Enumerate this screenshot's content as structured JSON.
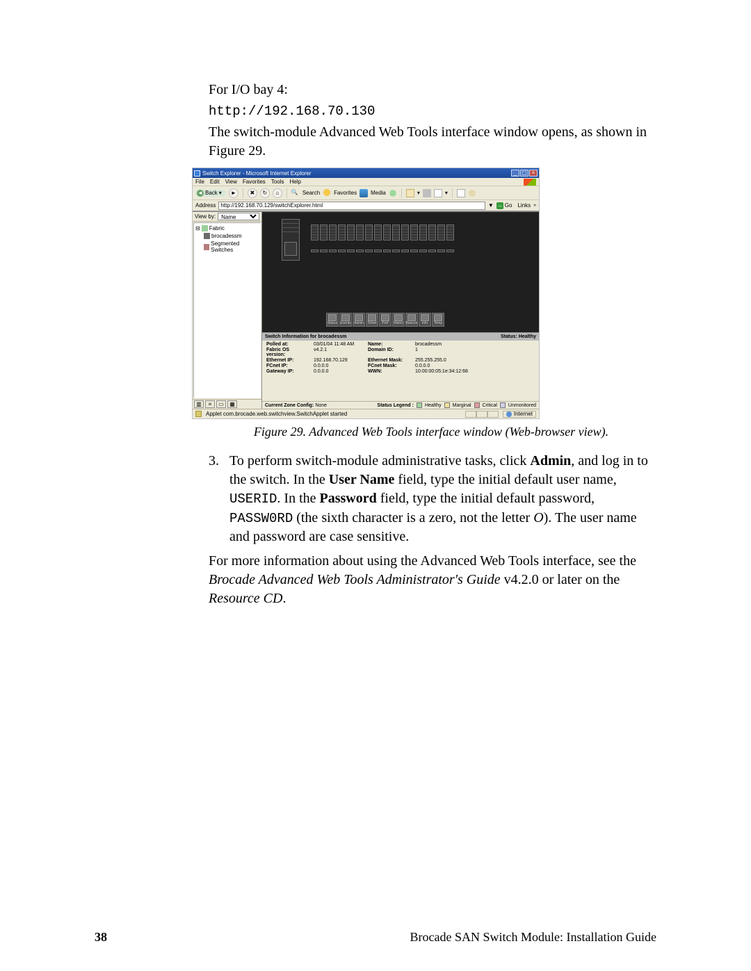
{
  "doc": {
    "bay_line": "For I/O bay 4:",
    "url": "http://192.168.70.130",
    "open_sentence": "The switch-module Advanced Web Tools interface window opens, as shown in Figure 29.",
    "caption": "Figure 29.  Advanced Web Tools interface window (Web-browser view).",
    "step3_num": "3.",
    "step3_a": "To perform switch-module administrative tasks, click ",
    "step3_admin": "Admin",
    "step3_b": ", and log in to the switch. In the ",
    "step3_user_label": "User Name",
    "step3_c": " field, type the initial default user name, ",
    "step3_userid": "USERID",
    "step3_d": ". In the ",
    "step3_pass_label": "Password",
    "step3_e": " field, type the initial default password, ",
    "step3_password": "PASSW0RD",
    "step3_f": " (the sixth character is a zero, not the letter ",
    "step3_O": "O",
    "step3_g": "). The user name and password are case sensitive.",
    "more_a": "For more information about using the Advanced Web Tools interface, see the ",
    "more_i1": "Brocade Advanced Web Tools Administrator's Guide",
    "more_b": " v4.2.0 or later on the ",
    "more_i2": "Resource CD",
    "more_c": ".",
    "page_number": "38",
    "footer_title": "Brocade SAN Switch Module: Installation Guide"
  },
  "ie": {
    "title": "Switch Explorer - Microsoft Internet Explorer",
    "menus": [
      "File",
      "Edit",
      "View",
      "Favorites",
      "Tools",
      "Help"
    ],
    "back": "Back",
    "tb": {
      "search": "Search",
      "favorites": "Favorites",
      "media": "Media"
    },
    "addr_label": "Address",
    "addr_value": "http://192.168.70.129/switchExplorer.html",
    "go": "Go",
    "links": "Links",
    "viewby": "View by:",
    "viewby_val": "Name",
    "tree": {
      "fabric": "Fabric",
      "switch": "brocadessm",
      "segmented": "Segmented Switches"
    },
    "icon_btns": [
      "Status",
      "Events",
      "Admin",
      "Telnet",
      "Perf",
      "Watch",
      "Beacon",
      "Info",
      "Temp"
    ],
    "info_title_prefix": "Switch Information for ",
    "info_title_name": "brocadessm",
    "status_label": "Status:",
    "status_value": "Healthy",
    "rows": {
      "polled_l": "Polled at:",
      "polled_v": "03/01/04 11:48 AM",
      "fos_l": "Fabric OS version:",
      "fos_v": "v4.2.1",
      "eip_l": "Ethernet IP:",
      "eip_v": "192.168.70.129",
      "fcip_l": "FCnet IP:",
      "fcip_v": "0.0.0.0",
      "gw_l": "Gateway IP:",
      "gw_v": "0.0.0.0",
      "name_l": "Name:",
      "name_v": "brocadessm",
      "did_l": "Domain ID:",
      "did_v": "1",
      "emask_l": "Ethernet Mask:",
      "emask_v": "255.255.255.0",
      "fcmask_l": "FCnet Mask:",
      "fcmask_v": "0.0.0.0",
      "wwn_l": "WWN:",
      "wwn_v": "10:00:00:05:1e:34:12:68"
    },
    "zone_label": "Current Zone Config:",
    "zone_value": "None",
    "legend_label": "Status Legend :",
    "legend": {
      "h": "Healthy",
      "m": "Marginal",
      "c": "Critical",
      "u": "Unmonitored"
    },
    "applet_status": "Applet com.brocade.web.switchview.SwitchApplet started",
    "internet": "Internet"
  }
}
